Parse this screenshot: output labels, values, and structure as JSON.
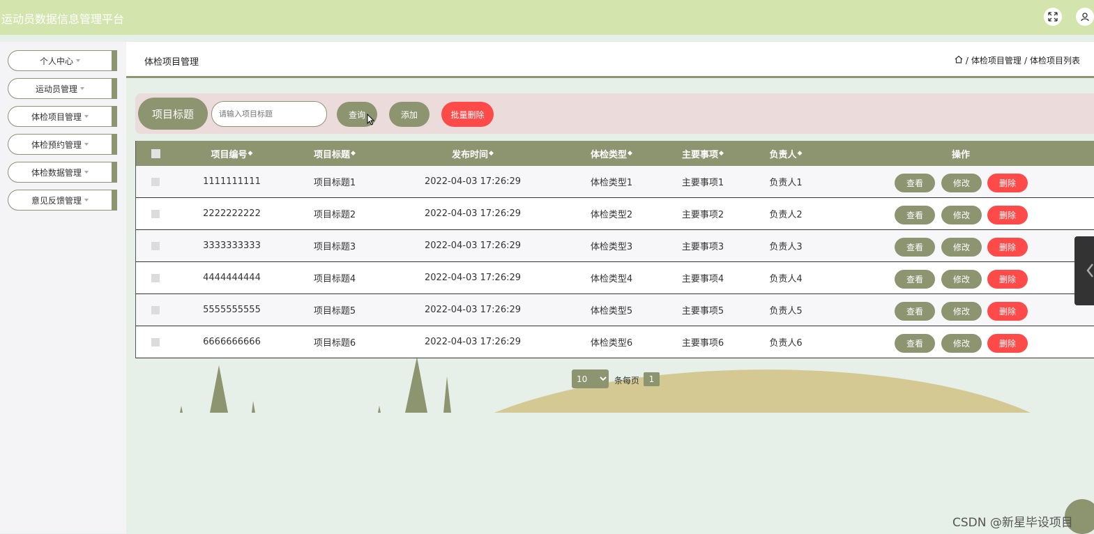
{
  "app": {
    "title": "运动员数据信息管理平台"
  },
  "topbar": {
    "icons": [
      "fullscreen-icon",
      "user-icon"
    ]
  },
  "sidebar": {
    "items": [
      {
        "label": "个人中心"
      },
      {
        "label": "运动员管理"
      },
      {
        "label": "体检项目管理"
      },
      {
        "label": "体检预约管理"
      },
      {
        "label": "体检数据管理"
      },
      {
        "label": "意见反馈管理"
      }
    ]
  },
  "header": {
    "page_title": "体检项目管理",
    "breadcrumb": [
      "体检项目管理",
      "体检项目列表"
    ],
    "breadcrumb_sep": "/"
  },
  "search": {
    "label": "项目标题",
    "placeholder": "请输入项目标题",
    "value": "",
    "query_button": "查询",
    "add_button": "添加",
    "batch_delete_button": "批量删除"
  },
  "table": {
    "columns": [
      "项目编号",
      "项目标题",
      "发布时间",
      "体检类型",
      "主要事项",
      "负责人",
      "操作"
    ],
    "sort_glyph": "◆",
    "rows": [
      {
        "id": "1111111111",
        "title": "项目标题1",
        "time": "2022-04-03 17:26:29",
        "type": "体检类型1",
        "matter": "主要事项1",
        "owner": "负责人1"
      },
      {
        "id": "2222222222",
        "title": "项目标题2",
        "time": "2022-04-03 17:26:29",
        "type": "体检类型2",
        "matter": "主要事项2",
        "owner": "负责人2"
      },
      {
        "id": "3333333333",
        "title": "项目标题3",
        "time": "2022-04-03 17:26:29",
        "type": "体检类型3",
        "matter": "主要事项3",
        "owner": "负责人3"
      },
      {
        "id": "4444444444",
        "title": "项目标题4",
        "time": "2022-04-03 17:26:29",
        "type": "体检类型4",
        "matter": "主要事项4",
        "owner": "负责人4"
      },
      {
        "id": "5555555555",
        "title": "项目标题5",
        "time": "2022-04-03 17:26:29",
        "type": "体检类型5",
        "matter": "主要事项5",
        "owner": "负责人5"
      },
      {
        "id": "6666666666",
        "title": "项目标题6",
        "time": "2022-04-03 17:26:29",
        "type": "体检类型6",
        "matter": "主要事项6",
        "owner": "负责人6"
      }
    ],
    "actions": {
      "view": "查看",
      "edit": "修改",
      "delete": "删除"
    }
  },
  "pagination": {
    "page_size": "10",
    "per_page_label": "条每页",
    "current_page": "1"
  },
  "watermark": "CSDN @新星毕设项目",
  "colors": {
    "accent": "#8d9470",
    "danger": "#ff4a4a",
    "topbar": "#d4e4ad",
    "search_bg": "#ebdbdb"
  }
}
